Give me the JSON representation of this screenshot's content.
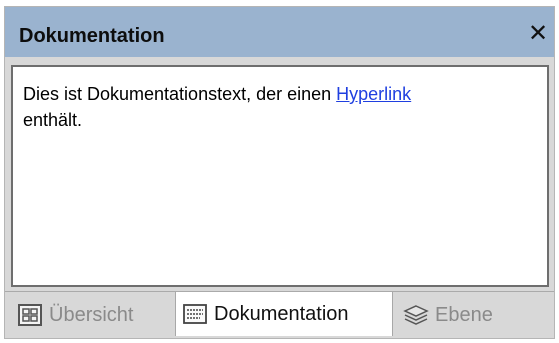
{
  "window": {
    "title": "Dokumentation",
    "close_glyph": "✕"
  },
  "content": {
    "text_before_link": "Dies ist Dokumentationstext, der einen ",
    "link_text": "Hyperlink",
    "text_after_link": "enthält.",
    "link_color": "#1f3fe0"
  },
  "tabs": [
    {
      "label": "Übersicht",
      "icon": "overview-icon",
      "active": false
    },
    {
      "label": "Dokumentation",
      "icon": "documentation-icon",
      "active": true
    },
    {
      "label": "Ebene",
      "icon": "layers-icon",
      "active": false
    }
  ],
  "colors": {
    "titlebar": "#9ab3cf",
    "panel_bg": "#d8d8d8"
  }
}
